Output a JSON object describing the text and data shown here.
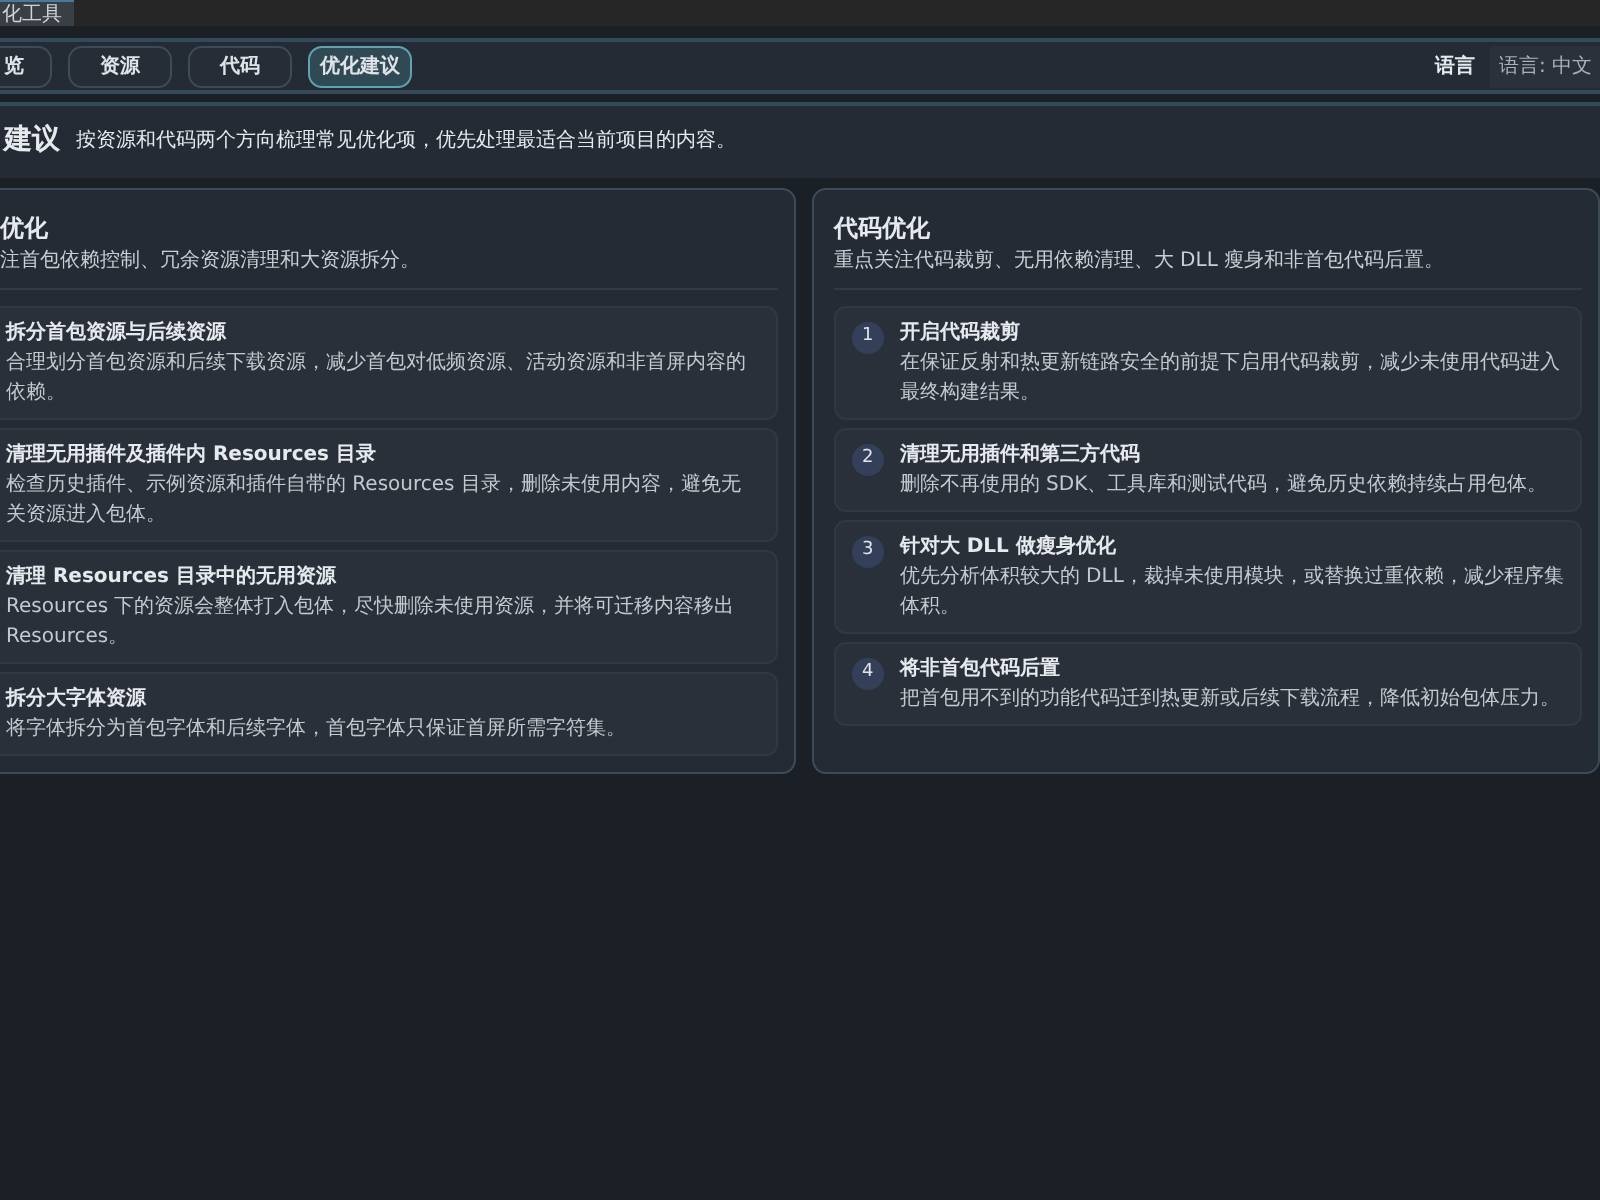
{
  "window": {
    "title": "化工具"
  },
  "tabs": [
    {
      "label": "览",
      "selected": false
    },
    {
      "label": "资源",
      "selected": false
    },
    {
      "label": "代码",
      "selected": false
    },
    {
      "label": "优化建议",
      "selected": true
    }
  ],
  "language": {
    "label": "语言",
    "value": "语言: 中文"
  },
  "header": {
    "title": "建议",
    "description": "按资源和代码两个方向梳理常见优化项，优先处理最适合当前项目的内容。"
  },
  "panels": [
    {
      "title": "优化",
      "subtitle": "注首包依赖控制、冗余资源清理和大资源拆分。",
      "items": [
        {
          "title": "拆分首包资源与后续资源",
          "description": "合理划分首包资源和后续下载资源，减少首包对低频资源、活动资源和非首屏内容的依赖。"
        },
        {
          "title": "清理无用插件及插件内 Resources 目录",
          "description": "检查历史插件、示例资源和插件自带的 Resources 目录，删除未使用内容，避免无关资源进入包体。"
        },
        {
          "title": "清理 Resources 目录中的无用资源",
          "description": "Resources 下的资源会整体打入包体，尽快删除未使用资源，并将可迁移内容移出 Resources。"
        },
        {
          "title": "拆分大字体资源",
          "description": "将字体拆分为首包字体和后续字体，首包字体只保证首屏所需字符集。"
        }
      ]
    },
    {
      "title": "代码优化",
      "subtitle": "重点关注代码裁剪、无用依赖清理、大 DLL 瘦身和非首包代码后置。",
      "items": [
        {
          "number": "1",
          "title": "开启代码裁剪",
          "description": "在保证反射和热更新链路安全的前提下启用代码裁剪，减少未使用代码进入最终构建结果。"
        },
        {
          "number": "2",
          "title": "清理无用插件和第三方代码",
          "description": "删除不再使用的 SDK、工具库和测试代码，避免历史依赖持续占用包体。"
        },
        {
          "number": "3",
          "title": "针对大 DLL 做瘦身优化",
          "description": "优先分析体积较大的 DLL，裁掉未使用模块，或替换过重依赖，减少程序集体积。"
        },
        {
          "number": "4",
          "title": "将非首包代码后置",
          "description": "把首包用不到的功能代码迁到热更新或后续下载流程，降低初始包体压力。"
        }
      ]
    }
  ]
}
